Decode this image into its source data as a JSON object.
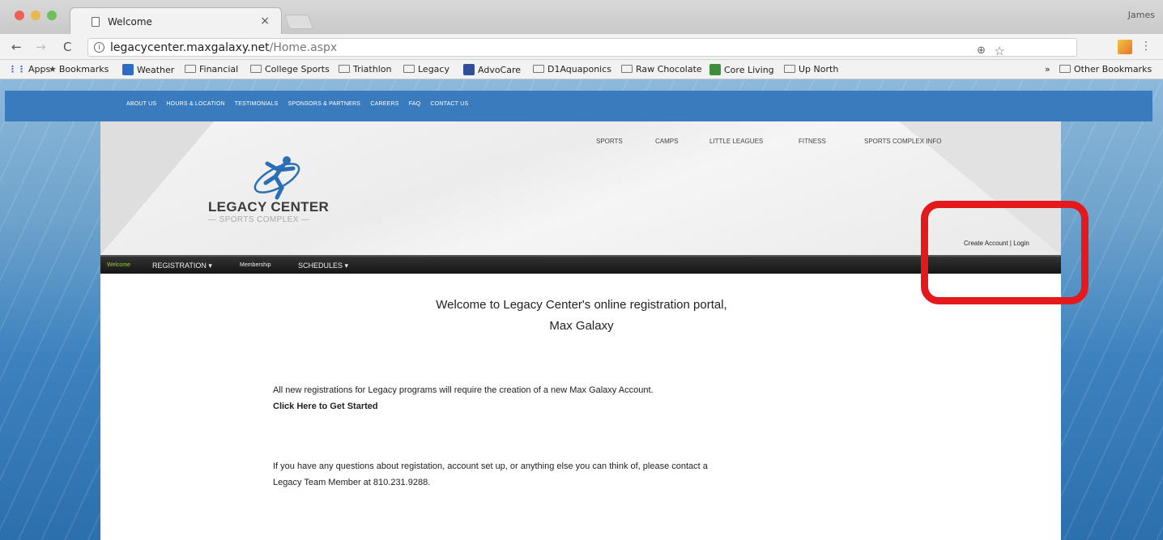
{
  "browser": {
    "tab_title": "Welcome",
    "tab_close": "×",
    "user_name": "James",
    "url_host": "legacycenter.maxgalaxy.net",
    "url_path": "/Home.aspx",
    "nav": {
      "back": "←",
      "forward": "→",
      "reload": "C",
      "info": "i"
    },
    "toolbar_icons": {
      "zoom": "⊕",
      "star": "☆",
      "menu": "⋮"
    },
    "bookmarks": [
      {
        "label": "Apps",
        "icon": "apps-icon"
      },
      {
        "label": "Bookmarks",
        "icon": "star-icon"
      },
      {
        "label": "Weather",
        "icon": "weather-icon"
      },
      {
        "label": "Financial",
        "icon": "folder-icon"
      },
      {
        "label": "College Sports",
        "icon": "folder-icon"
      },
      {
        "label": "Triathlon",
        "icon": "folder-icon"
      },
      {
        "label": "Legacy",
        "icon": "folder-icon"
      },
      {
        "label": "AdvoCare",
        "icon": "advocare-icon"
      },
      {
        "label": "D1Aquaponics",
        "icon": "folder-icon"
      },
      {
        "label": "Raw Chocolate",
        "icon": "folder-icon"
      },
      {
        "label": "Core Living",
        "icon": "core-living-icon"
      },
      {
        "label": "Up North",
        "icon": "folder-icon"
      },
      {
        "label": "Other Bookmarks",
        "icon": "folder-icon"
      }
    ],
    "bookmarks_overflow": "»"
  },
  "site": {
    "top_nav": [
      "ABOUT US",
      "HOURS & LOCATION",
      "TESTIMONIALS",
      "SPONSORS & PARTNERS",
      "CAREERS",
      "FAQ",
      "CONTACT US"
    ],
    "logo_title": "LEGACY CENTER",
    "logo_subtitle": "— SPORTS COMPLEX —",
    "main_nav": [
      "SPORTS",
      "CAMPS",
      "LITTLE LEAGUES",
      "FITNESS",
      "SPORTS COMPLEX INFO"
    ],
    "account_link": "Create Account | Login",
    "sub_nav": [
      {
        "label": "Welcome",
        "active": true
      },
      {
        "label": "REGISTRATION ▾"
      },
      {
        "label": "Membership"
      },
      {
        "label": "SCHEDULES ▾"
      }
    ],
    "welcome_line1": "Welcome to Legacy Center's online registration portal,",
    "welcome_line2": "Max Galaxy",
    "notice": "All new registrations for Legacy programs will require the creation of a new Max Galaxy Account.",
    "get_started_link": "Click Here to Get Started",
    "contact_line1": "If you have any questions about registation, account set up, or anything else you can think of, please contact a",
    "contact_line2": "Legacy Team Member at 810.231.9288."
  },
  "colors": {
    "top_bar": "#3a7bbd",
    "highlight_box": "#e3191b",
    "active_subnav": "#9ccc3c",
    "logo_blue": "#2a6fb5"
  }
}
